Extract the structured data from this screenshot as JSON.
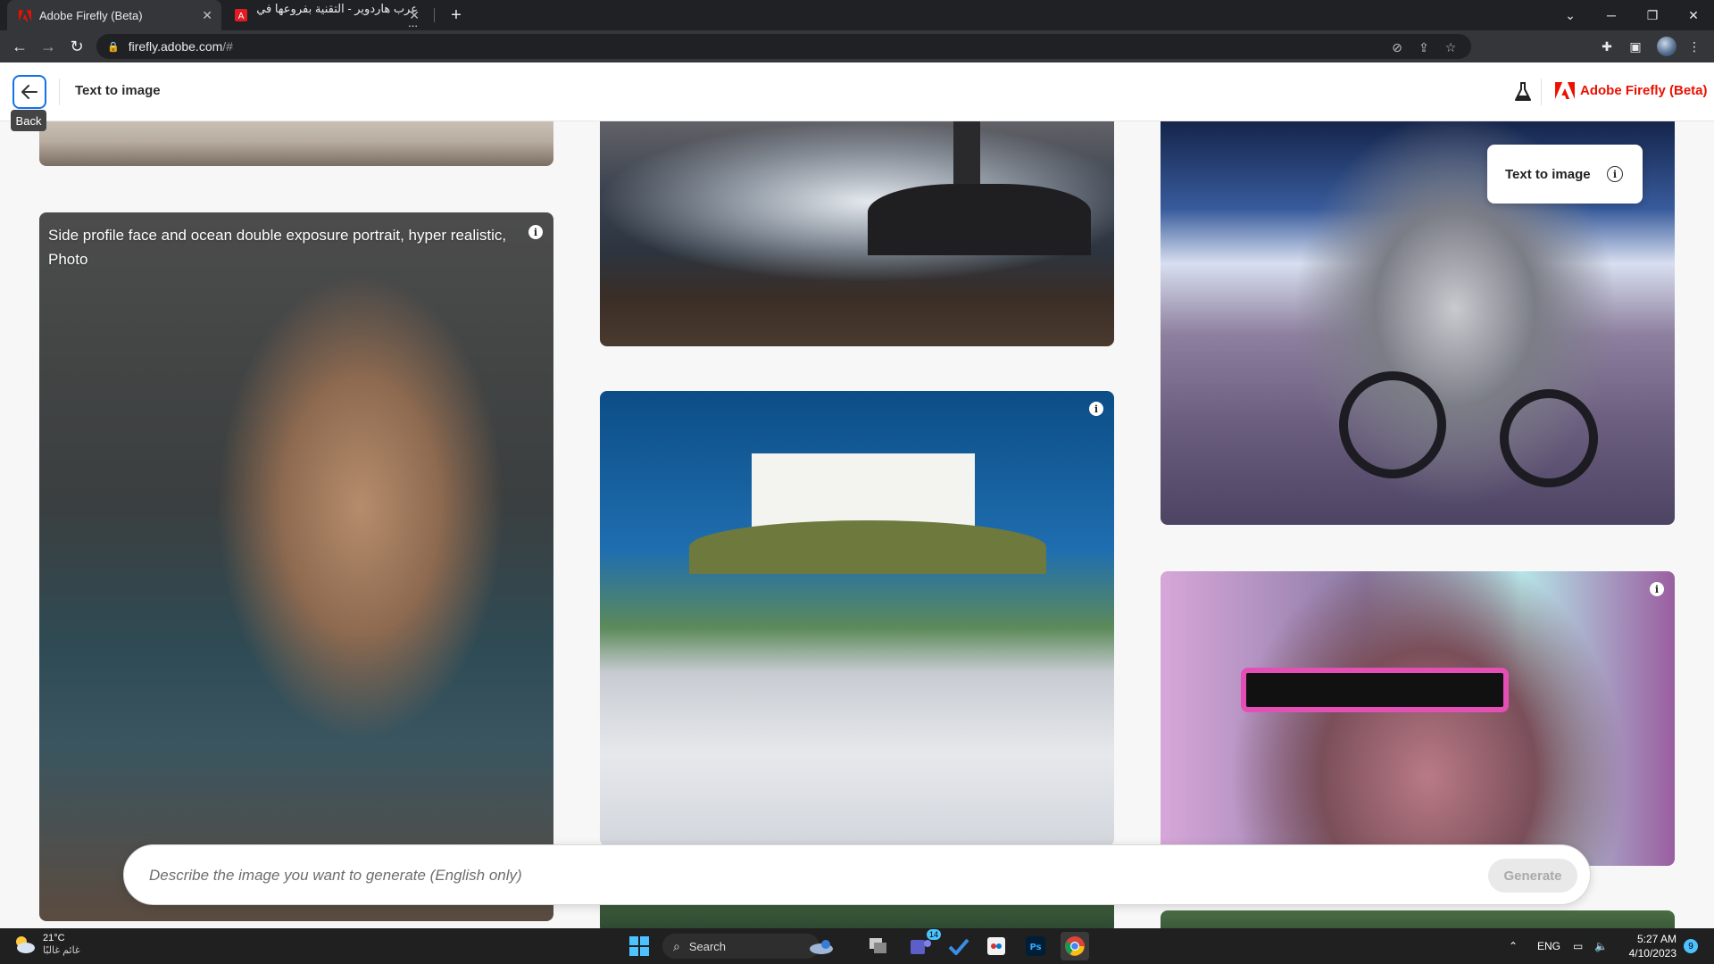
{
  "browser": {
    "tabs": [
      {
        "title": "Adobe Firefly (Beta)",
        "active": true
      },
      {
        "title": "عرب هاردوير - التقنية بفروعها في ...",
        "active": false
      }
    ],
    "new_tab_symbol": "+",
    "url_host": "firefly.adobe.com",
    "url_path": "/#"
  },
  "app_header": {
    "back_tooltip": "Back",
    "title": "Text to image",
    "brand": "Adobe Firefly (Beta)"
  },
  "gallery": {
    "portrait_prompt": "Side profile face and ocean double exposure portrait, hyper realistic, Photo",
    "info_symbol": "i",
    "text_to_image_panel": "Text to image"
  },
  "prompt": {
    "placeholder": "Describe the image you want to generate (English only)",
    "generate_label": "Generate"
  },
  "taskbar": {
    "temperature": "21°C",
    "weather_desc": "غائم غالبًا",
    "search_label": "Search",
    "teams_badge": "14",
    "language": "ENG",
    "time": "5:27 AM",
    "date": "4/10/2023",
    "notifications": "9"
  },
  "colors": {
    "adobe_red": "#eb1000",
    "accent_blue": "#1473e6"
  }
}
